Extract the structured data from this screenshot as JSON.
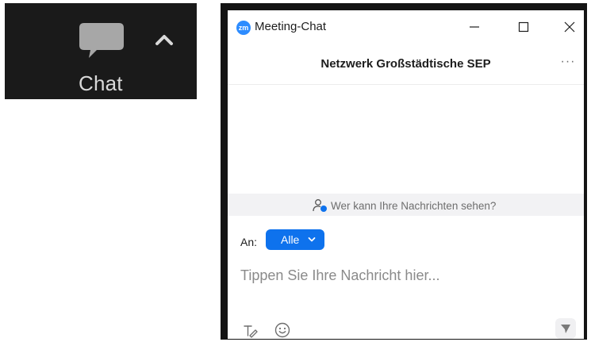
{
  "toolbar": {
    "chat_label": "Chat",
    "chat_icon": "chat-bubble-icon",
    "caret_icon": "caret-up-icon",
    "background": "#1a1a1a",
    "text_color": "#d9d9d9"
  },
  "window": {
    "logo_text": "zm",
    "title": "Meeting-Chat",
    "controls": [
      "minimize-icon",
      "maximize-icon",
      "close-icon"
    ]
  },
  "header": {
    "title": "Netzwerk Großstädtische SEP",
    "more_label": "···"
  },
  "banner": {
    "text": "Wer kann Ihre Nachrichten sehen?",
    "icon": "person-lock-icon"
  },
  "composer": {
    "to_label": "An:",
    "recipient": "Alle",
    "placeholder": "Tippen Sie Ihre Nachricht hier...",
    "value": "",
    "tools": [
      "format-icon",
      "emoji-icon",
      "send-icon"
    ]
  },
  "colors": {
    "accent": "#0e72ed",
    "logo": "#2d8cff",
    "banner_bg": "#f2f2f4"
  }
}
